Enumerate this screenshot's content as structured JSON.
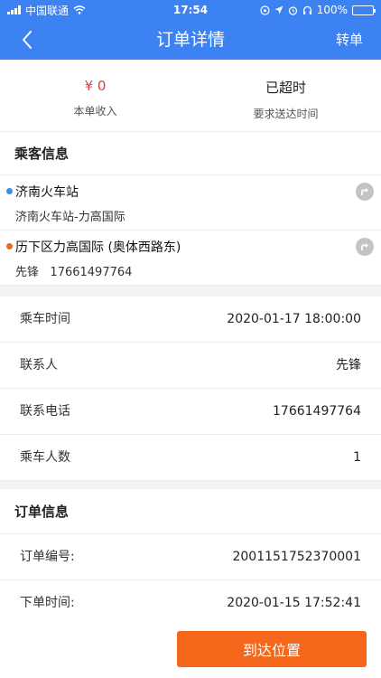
{
  "status_bar": {
    "carrier": "中国联通",
    "time": "17:54",
    "battery": "100%",
    "battery_level": 1.0
  },
  "nav": {
    "title": "订单详情",
    "back_icon": "chevron-left-icon",
    "transfer_label": "转单"
  },
  "summary": {
    "income_value": "¥ 0",
    "income_label": "本单收入",
    "deadline_value": "已超时",
    "deadline_label": "要求送达时间"
  },
  "passenger": {
    "title": "乘客信息",
    "pickup": {
      "name": "济南火车站",
      "detail": "济南火车站-力高国际",
      "dot_color": "#3a8ee6"
    },
    "dropoff": {
      "name": "历下区力高国际 (奥体西路东)",
      "contact_name": "先锋",
      "contact_phone": "17661497764",
      "dot_color": "#f0641e"
    }
  },
  "trip": {
    "rows": [
      {
        "label": "乘车时间",
        "value": "2020-01-17 18:00:00"
      },
      {
        "label": "联系人",
        "value": "先锋"
      },
      {
        "label": "联系电话",
        "value": "17661497764"
      },
      {
        "label": "乘车人数",
        "value": "1"
      }
    ]
  },
  "order": {
    "title": "订单信息",
    "rows": [
      {
        "label": "订单编号:",
        "value": "2001151752370001"
      },
      {
        "label": "下单时间:",
        "value": "2020-01-15 17:52:41"
      }
    ]
  },
  "footer": {
    "arrive_label": "到达位置",
    "button_color": "#f5681c"
  },
  "colors": {
    "header": "#3d82f3",
    "income": "#e53935"
  }
}
